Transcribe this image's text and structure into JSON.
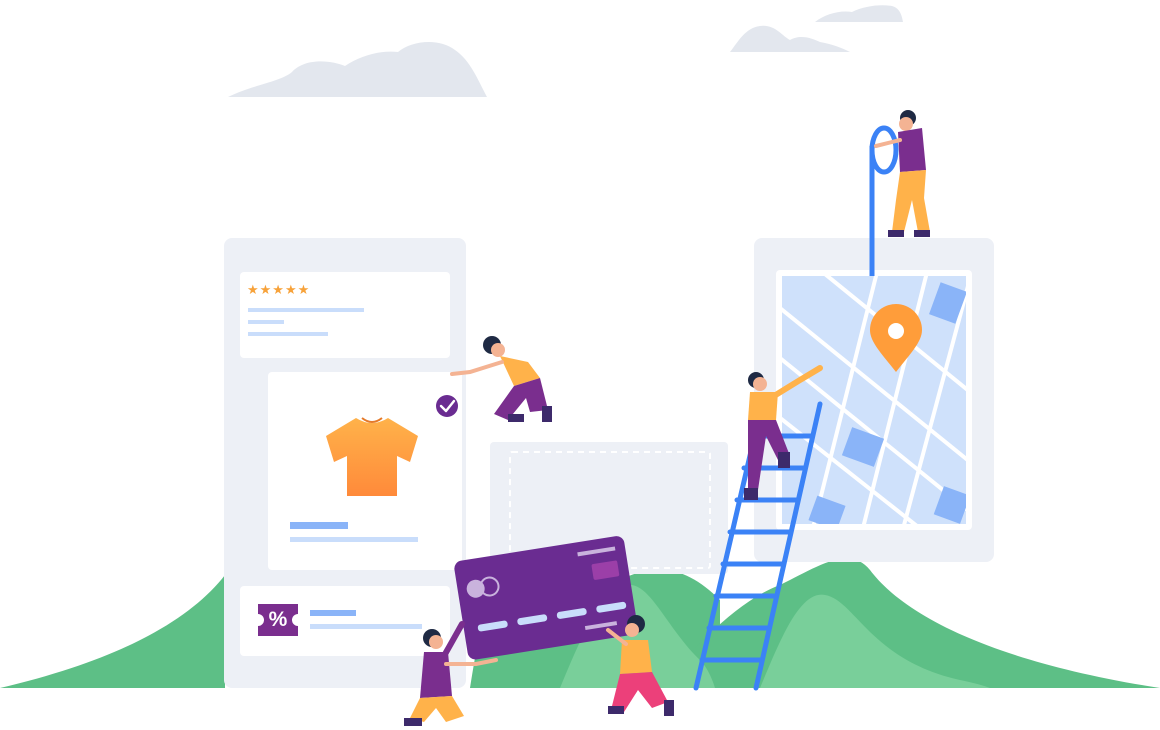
{
  "scene": {
    "rating_stars": "★★★★★",
    "discount_badge": "%"
  },
  "colors": {
    "hill_green": "#5dbf86",
    "hill_light": "#79cf9a",
    "card_purple": "#6a2c91",
    "badge_purple": "#7a2e8e",
    "accent_blue": "#3b82f6",
    "map_blue": "#cfe1fb",
    "shirt_orange": "#ff9a3d",
    "pin_orange": "#ff9d3a",
    "star_orange": "#f7a23a",
    "cloud_gray": "#e3e7ee",
    "panel_gray": "#edf0f6"
  },
  "icons": {
    "product": "t-shirt-icon",
    "location": "map-pin-icon",
    "confirm": "checkmark-icon",
    "discount": "coupon-icon",
    "payment": "credit-card-icon"
  }
}
